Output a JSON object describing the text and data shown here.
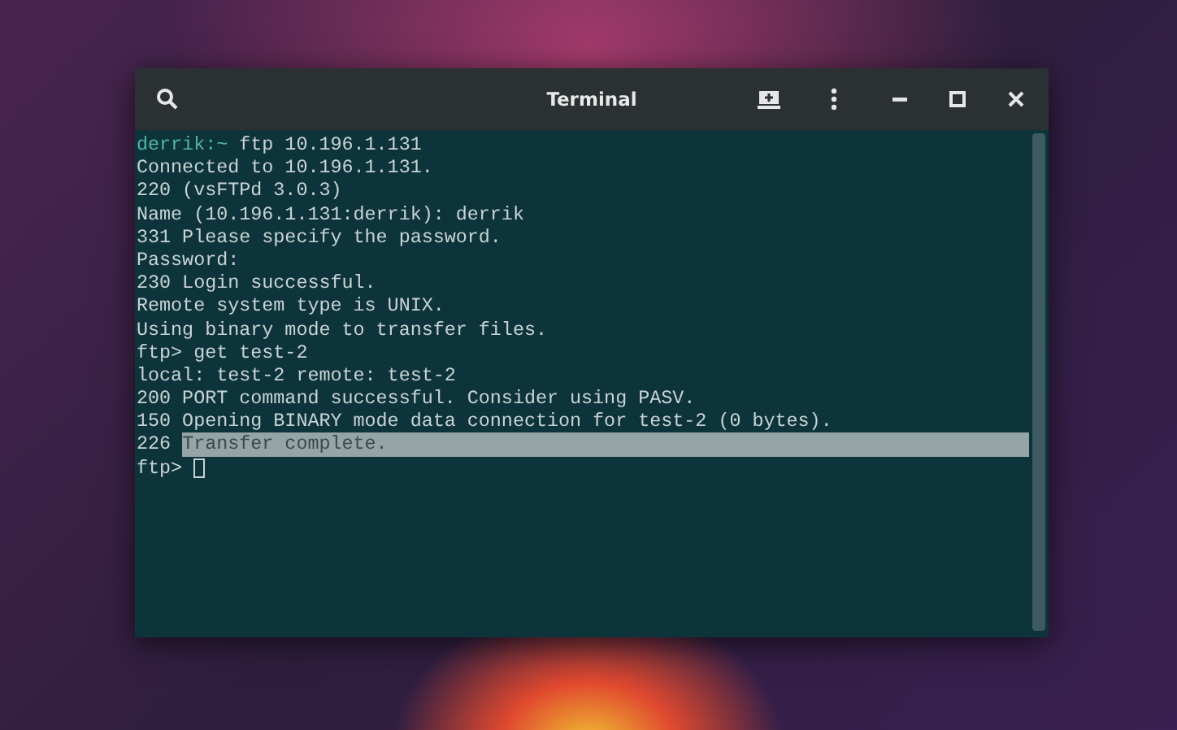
{
  "window": {
    "title": "Terminal"
  },
  "terminal": {
    "lines": [
      {
        "prompt": "derrik:~",
        "text": " ftp 10.196.1.131"
      },
      {
        "text": "Connected to 10.196.1.131."
      },
      {
        "text": "220 (vsFTPd 3.0.3)"
      },
      {
        "text": "Name (10.196.1.131:derrik): derrik"
      },
      {
        "text": "331 Please specify the password."
      },
      {
        "text": "Password:"
      },
      {
        "text": "230 Login successful."
      },
      {
        "text": "Remote system type is UNIX."
      },
      {
        "text": "Using binary mode to transfer files."
      },
      {
        "text": "ftp> get test-2"
      },
      {
        "text": "local: test-2 remote: test-2"
      },
      {
        "text": "200 PORT command successful. Consider using PASV."
      },
      {
        "text": "150 Opening BINARY mode data connection for test-2 (0 bytes)."
      },
      {
        "text": "226 ",
        "selected_text": "Transfer complete."
      },
      {
        "text": "ftp> ",
        "cursor": true
      }
    ]
  }
}
